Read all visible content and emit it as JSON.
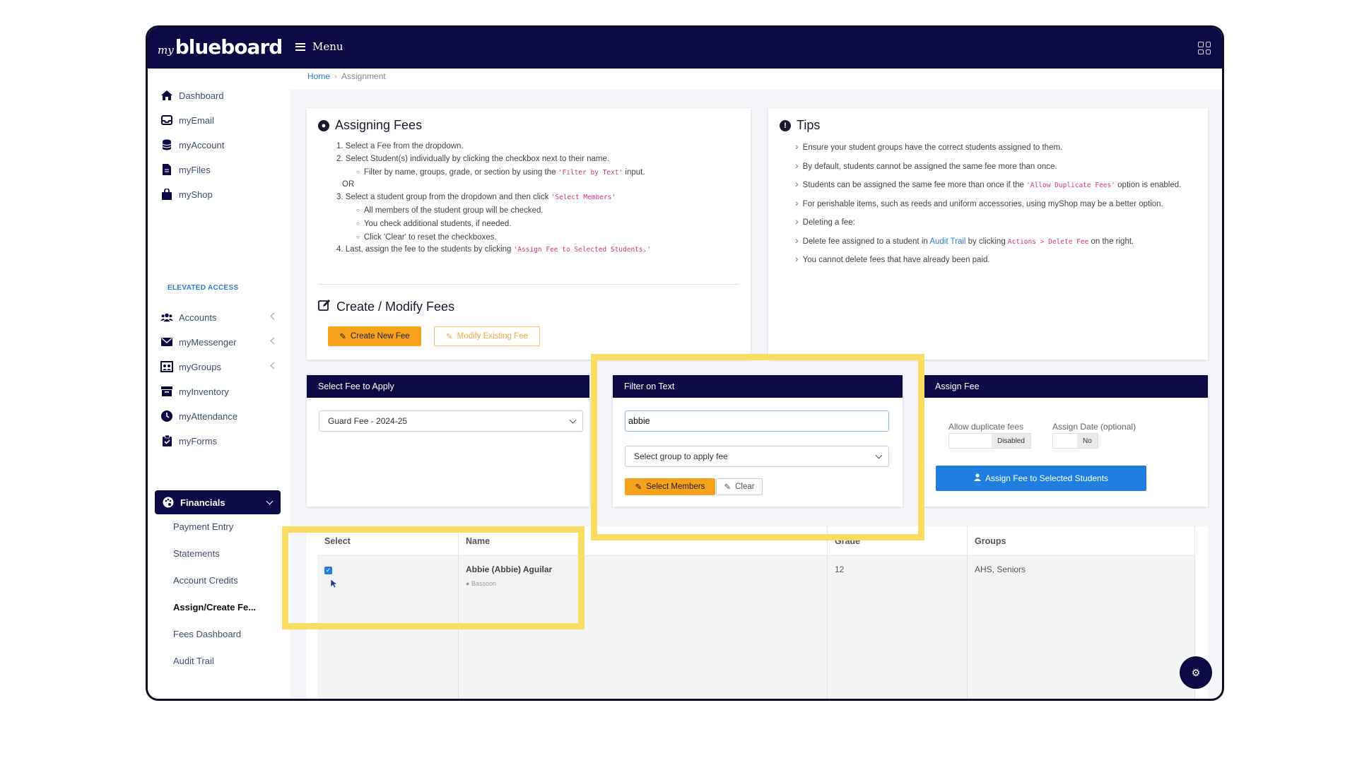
{
  "header": {
    "logo_my": "my",
    "logo_main": "blueboard",
    "menu_label": "Menu"
  },
  "breadcrumb": {
    "home": "Home",
    "current": "Assignment"
  },
  "sidebar": {
    "items": [
      {
        "label": "Dashboard",
        "icon": "home-icon"
      },
      {
        "label": "myEmail",
        "icon": "inbox-icon"
      },
      {
        "label": "myAccount",
        "icon": "database-icon"
      },
      {
        "label": "myFiles",
        "icon": "file-icon"
      },
      {
        "label": "myShop",
        "icon": "bag-icon"
      }
    ],
    "elevated_label": "ELEVATED ACCESS",
    "elevated_items": [
      {
        "label": "Accounts",
        "icon": "users-icon"
      },
      {
        "label": "myMessenger",
        "icon": "envelope-icon"
      },
      {
        "label": "myGroups",
        "icon": "groups-icon"
      },
      {
        "label": "myInventory",
        "icon": "archive-icon"
      },
      {
        "label": "myAttendance",
        "icon": "clock-icon"
      },
      {
        "label": "myForms",
        "icon": "clipboard-check-icon"
      }
    ],
    "active": {
      "label": "Financials",
      "icon": "palette-icon"
    },
    "sub_items": [
      "Payment Entry",
      "Statements",
      "Account Credits",
      "Assign/Create Fe...",
      "Fees Dashboard",
      "Audit Trail"
    ]
  },
  "assigning": {
    "title": "Assigning Fees",
    "step1": "1. Select a Fee from the dropdown.",
    "step2": "2. Select Student(s) individually by clicking the checkbox next to their name.",
    "step2a_pre": "Filter by name, groups, grade, or section by using the ",
    "step2a_code": "'Filter by Text'",
    "step2a_post": " input.",
    "or": "OR",
    "step3_pre": "3. Select a student group from the dropdown and then click ",
    "step3_code": "'Select Members'",
    "step3a": "All members of the student group will be checked.",
    "step3b": "You check additional students, if needed.",
    "step3c": "Click 'Clear' to reset the checkboxes.",
    "step4_pre": "4. Last, assign the fee to the students by clicking ",
    "step4_code": "'Assign Fee to Selected Students.'"
  },
  "create": {
    "title": "Create / Modify Fees",
    "new_label": "Create New Fee",
    "modify_label": "Modify Existing Fee"
  },
  "tips": {
    "title": "Tips",
    "t1": "Ensure your student groups have the correct students assigned to them.",
    "t2": "By default, students cannot be assigned the same fee more than once.",
    "t3_pre": "Students can be assigned the same fee more than once if the ",
    "t3_code": "'Allow Duplicate Fees'",
    "t3_post": " option is enabled.",
    "t4": "For perishable items, such as reeds and uniform accessories, using myShop may be a better option.",
    "t5": "Deleting a fee:",
    "t6_pre": "Delete fee assigned to a student in ",
    "t6_link": "Audit Trail",
    "t6_mid": " by clicking ",
    "t6_code": "Actions > Delete Fee",
    "t6_post": " on the right.",
    "t7": "You cannot delete fees that have already been paid."
  },
  "select_fee": {
    "header": "Select Fee to Apply",
    "value": "Guard Fee - 2024-25"
  },
  "filter": {
    "header": "Filter on Text",
    "value": "abbie",
    "group_placeholder": "Select group to apply fee",
    "select_members": "Select Members",
    "clear": "Clear"
  },
  "assign": {
    "header": "Assign Fee",
    "dup_label": "Allow duplicate fees",
    "dup_value": "Disabled",
    "date_label": "Assign Date (optional)",
    "date_value": "No",
    "button": "Assign Fee to Selected Students"
  },
  "table": {
    "columns": [
      "Select",
      "Name",
      "Grade",
      "Groups"
    ],
    "rows": [
      {
        "name": "Abbie (Abbie) Aguilar",
        "section": "Bassoon",
        "grade": "12",
        "groups": "AHS, Seniors",
        "checked": true
      }
    ]
  },
  "colors": {
    "navy": "#0c0a44",
    "orange": "#f7a21c",
    "blue": "#1e7fe0",
    "highlight": "#f9dc62"
  }
}
